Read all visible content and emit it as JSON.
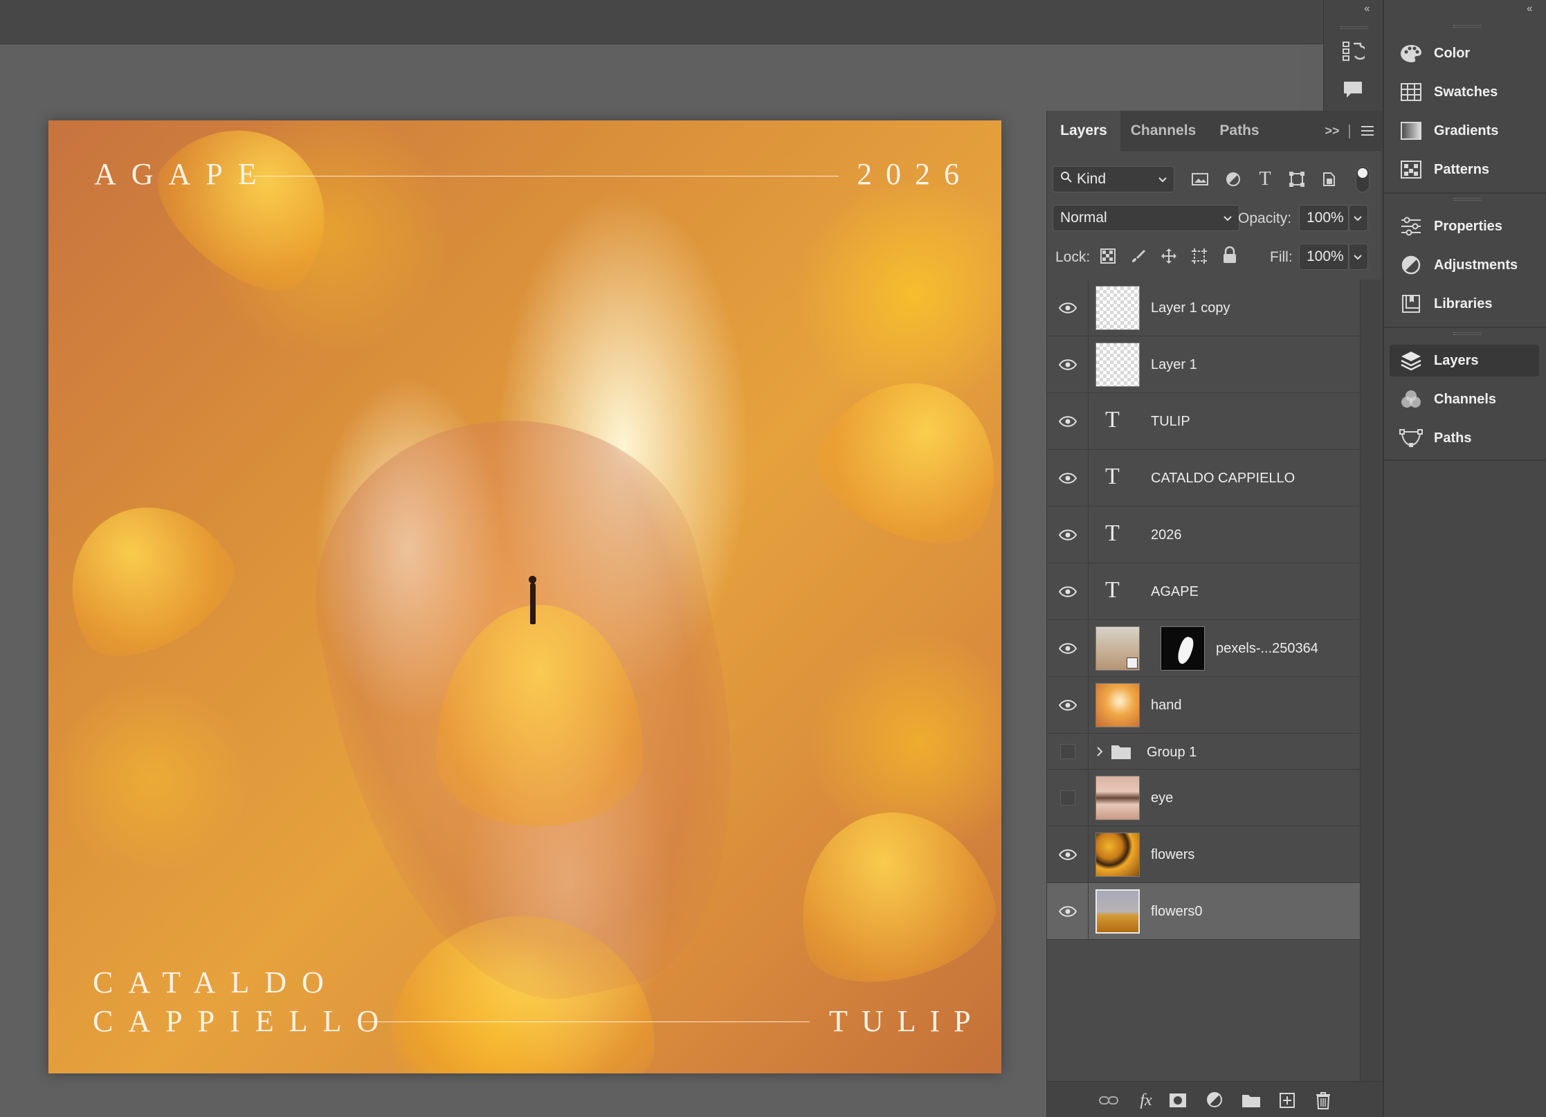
{
  "artwork": {
    "top_left_text": "AGAPE",
    "top_right_text": "2026",
    "bottom_left_line1": "CATALDO",
    "bottom_left_line2": "CAPPIELLO",
    "bottom_right_text": "TULIP"
  },
  "icon_column": {
    "items": [
      {
        "icon": "history-icon"
      },
      {
        "icon": "comments-icon"
      }
    ]
  },
  "dock": {
    "groups": [
      {
        "items": [
          {
            "label": "Color",
            "icon": "palette-icon"
          },
          {
            "label": "Swatches",
            "icon": "swatches-grid-icon"
          },
          {
            "label": "Gradients",
            "icon": "gradient-icon"
          },
          {
            "label": "Patterns",
            "icon": "patterns-icon"
          }
        ]
      },
      {
        "items": [
          {
            "label": "Properties",
            "icon": "sliders-icon"
          },
          {
            "label": "Adjustments",
            "icon": "adjustment-circle-icon"
          },
          {
            "label": "Libraries",
            "icon": "libraries-icon"
          }
        ]
      },
      {
        "items": [
          {
            "label": "Layers",
            "icon": "layers-stack-icon",
            "active": true
          },
          {
            "label": "Channels",
            "icon": "channels-icon"
          },
          {
            "label": "Paths",
            "icon": "pen-path-icon"
          }
        ]
      }
    ]
  },
  "layers_panel": {
    "tabs": [
      {
        "label": "Layers",
        "active": true
      },
      {
        "label": "Channels"
      },
      {
        "label": "Paths"
      }
    ],
    "overflow_symbol": ">>",
    "filter": {
      "label": "Kind",
      "icons": [
        "image-filter-icon",
        "adjustment-filter-icon",
        "type-filter-icon",
        "shape-filter-icon",
        "smart-object-filter-icon"
      ]
    },
    "blend_mode": "Normal",
    "opacity_label": "Opacity:",
    "opacity_value": "100%",
    "lock_label": "Lock:",
    "fill_label": "Fill:",
    "fill_value": "100%",
    "layers": [
      {
        "name": "Layer 1 copy",
        "visible": true,
        "kind": "pixel-empty"
      },
      {
        "name": "Layer 1",
        "visible": true,
        "kind": "pixel-empty"
      },
      {
        "name": "TULIP",
        "visible": true,
        "kind": "text"
      },
      {
        "name": "CATALDO CAPPIELLO",
        "visible": true,
        "kind": "text"
      },
      {
        "name": "2026",
        "visible": true,
        "kind": "text"
      },
      {
        "name": "AGAPE",
        "visible": true,
        "kind": "text"
      },
      {
        "name": "pexels-...250364",
        "visible": true,
        "kind": "smart-masked"
      },
      {
        "name": "hand",
        "visible": true,
        "kind": "image"
      },
      {
        "name": "Group 1",
        "visible": false,
        "kind": "group"
      },
      {
        "name": "eye",
        "visible": false,
        "kind": "image"
      },
      {
        "name": "flowers",
        "visible": true,
        "kind": "image"
      },
      {
        "name": "flowers0",
        "visible": true,
        "kind": "image",
        "selected": true
      }
    ],
    "footer_icons": [
      "link-layers-icon",
      "fx-icon",
      "add-mask-icon",
      "adjustment-layer-icon",
      "new-group-icon",
      "new-layer-icon",
      "delete-icon"
    ],
    "footer_fx_label": "fx"
  },
  "colors": {
    "accent_selected_row": "#656565",
    "panel_bg": "#4b4b4b",
    "artwork_warm": "#d98e3a"
  }
}
